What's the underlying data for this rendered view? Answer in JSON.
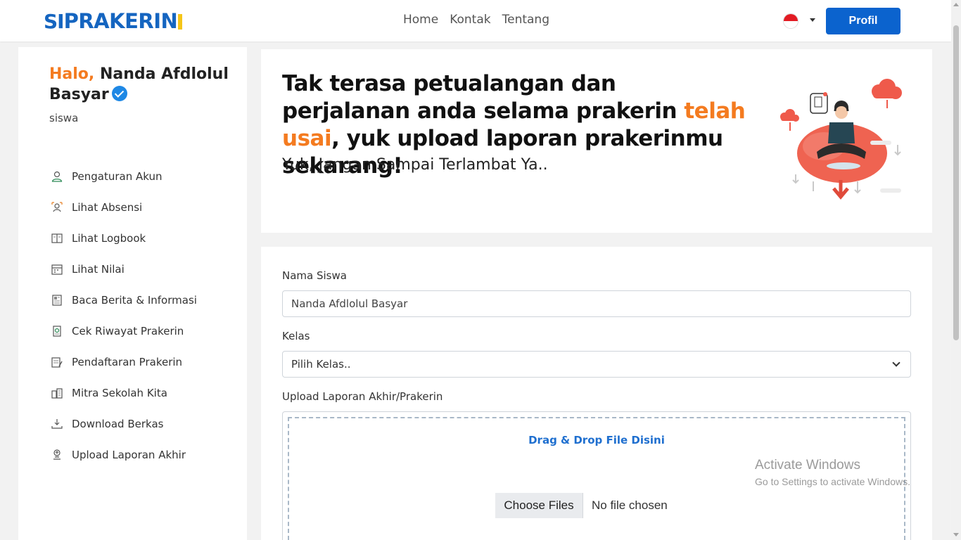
{
  "brand": {
    "logo_prefix": "SI",
    "logo_text": "PRAKERIN"
  },
  "nav": {
    "links": [
      "Home",
      "Kontak",
      "Tentang"
    ],
    "profile_button": "Profil",
    "language_flag": "id"
  },
  "sidebar": {
    "greeting_prefix": "Halo,",
    "user_name": "Nanda Afdlolul Basyar",
    "role": "siswa",
    "items": [
      {
        "label": "Pengaturan Akun",
        "icon": "user-settings-icon"
      },
      {
        "label": "Lihat Absensi",
        "icon": "attendance-icon"
      },
      {
        "label": "Lihat Logbook",
        "icon": "logbook-icon"
      },
      {
        "label": "Lihat Nilai",
        "icon": "calendar-grade-icon"
      },
      {
        "label": "Baca Berita & Informasi",
        "icon": "news-icon"
      },
      {
        "label": "Cek Riwayat Prakerin",
        "icon": "history-icon"
      },
      {
        "label": "Pendaftaran Prakerin",
        "icon": "registration-icon"
      },
      {
        "label": "Mitra Sekolah Kita",
        "icon": "partner-icon"
      },
      {
        "label": "Download Berkas",
        "icon": "download-icon"
      },
      {
        "label": "Upload Laporan Akhir",
        "icon": "upload-icon"
      }
    ]
  },
  "hero": {
    "title_part1": "Tak terasa petualangan dan perjalanan anda selama prakerin ",
    "title_accent": "telah usai",
    "title_part2": ", yuk upload laporan prakerinmu sekarang!",
    "subtitle": "Yuk, Jangan Sampai Terlambat Ya.."
  },
  "form": {
    "name_label": "Nama Siswa",
    "name_value": "Nanda Afdlolul Basyar",
    "class_label": "Kelas",
    "class_value": "Pilih Kelas..",
    "upload_label": "Upload Laporan Akhir/Prakerin",
    "dropzone_text": "Drag & Drop File Disini",
    "choose_files": "Choose Files",
    "no_file": "No file chosen"
  },
  "watermark": {
    "line1": "Activate Windows",
    "line2": "Go to Settings to activate Windows."
  },
  "colors": {
    "primary": "#0b63ce",
    "accent": "#f47b20",
    "logo_blue": "#1565c0",
    "logo_yellow": "#f5c518"
  }
}
